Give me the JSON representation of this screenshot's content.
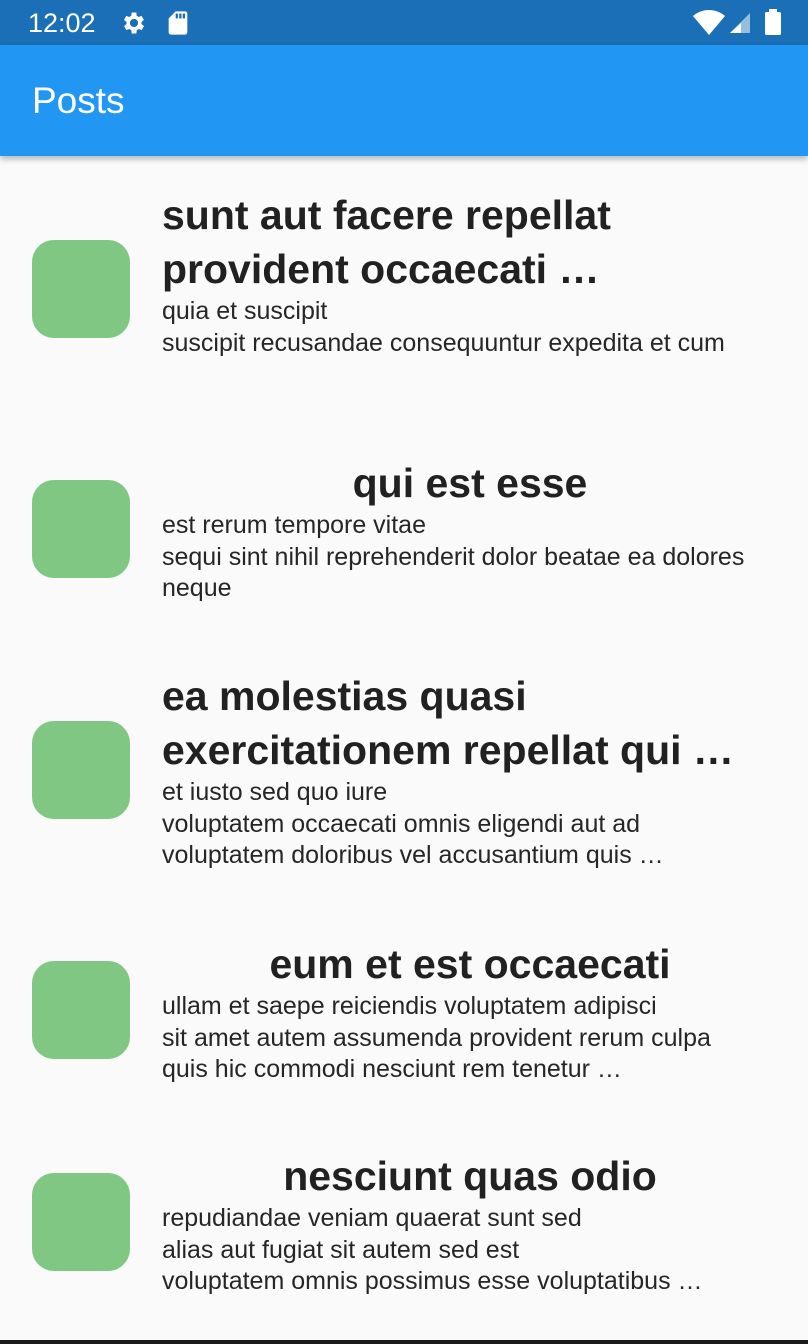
{
  "status_bar": {
    "time": "12:02",
    "icons": [
      "gear-icon",
      "sd-card-icon",
      "wifi-icon",
      "signal-icon",
      "battery-icon"
    ],
    "color": "#1a6fb6"
  },
  "app_bar": {
    "title": "Posts",
    "color": "#2196f3"
  },
  "avatar_color": "#81c784",
  "posts": [
    {
      "title": "sunt aut facere repellat provident occaecati …",
      "body": "quia et suscipit\nsuscipit recusandae consequuntur expedita et cum"
    },
    {
      "title": "qui est esse",
      "body": "est rerum tempore vitae\nsequi sint nihil reprehenderit dolor beatae ea dolores neque"
    },
    {
      "title": "ea molestias quasi exercitationem repellat qui …",
      "body": "et iusto sed quo iure\nvoluptatem occaecati omnis eligendi aut ad\nvoluptatem doloribus vel accusantium quis …"
    },
    {
      "title": "eum et est occaecati",
      "body": "ullam et saepe reiciendis voluptatem adipisci\nsit amet autem assumenda provident rerum culpa\nquis hic commodi nesciunt rem tenetur …"
    },
    {
      "title": "nesciunt quas odio",
      "body": "repudiandae veniam quaerat sunt sed\nalias aut fugiat sit autem sed est\nvoluptatem omnis possimus esse voluptatibus …"
    }
  ]
}
